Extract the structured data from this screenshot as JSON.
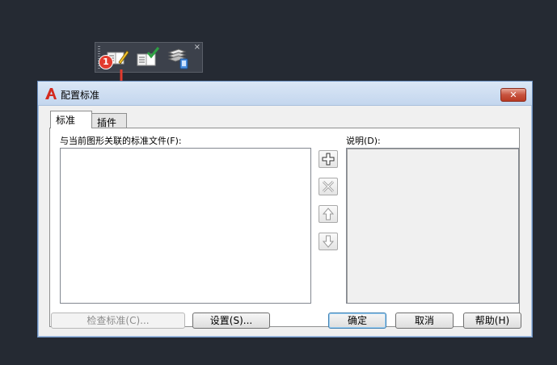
{
  "annotation": {
    "badge_number": "1"
  },
  "toolbar": {
    "icons": [
      "configure-standards-icon",
      "check-standards-icon",
      "layer-translator-icon"
    ],
    "close_glyph": "×"
  },
  "dialog": {
    "title": "配置标准",
    "close_glyph": "✕",
    "tabs": [
      {
        "label": "标准"
      },
      {
        "label": "插件"
      }
    ],
    "files_label": "与当前图形关联的标准文件(F):",
    "description_label": "说明(D):",
    "buttons": {
      "check": "检查标准(C)...",
      "settings": "设置(S)...",
      "ok": "确定",
      "cancel": "取消",
      "help": "帮助(H)"
    }
  },
  "colors": {
    "background": "#252a33",
    "badge": "#e23b2e",
    "close": "#c7523d",
    "accent_green": "#2ea043"
  }
}
